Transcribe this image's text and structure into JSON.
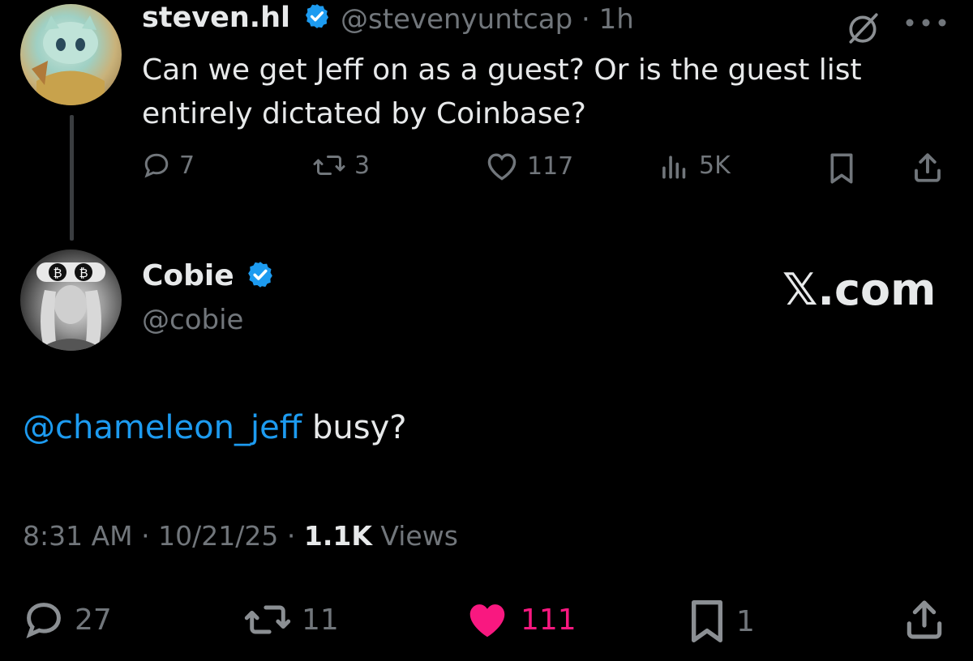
{
  "parent": {
    "display_name": "steven.hl",
    "handle": "@stevenyuntcap",
    "separator": "·",
    "time": "1h",
    "text": "Can we get Jeff on as a guest? Or is the guest list entirely dictated by Coinbase?",
    "counts": {
      "replies": "7",
      "reposts": "3",
      "likes": "117",
      "views": "5K"
    }
  },
  "main": {
    "display_name": "Cobie",
    "handle": "@cobie",
    "watermark": "𝕏.com",
    "mention": "@chameleon_jeff",
    "text_rest": " busy?",
    "time": "8:31 AM",
    "date": "10/21/25",
    "views_count": "1.1K",
    "views_label": "Views",
    "counts": {
      "replies": "27",
      "reposts": "11",
      "likes": "111",
      "bookmarks": "1"
    }
  },
  "colors": {
    "background": "#000000",
    "text": "#e7e9ea",
    "muted": "#71767b",
    "link": "#1d9bf0",
    "like": "#f91880",
    "verified": "#1d9bf0"
  },
  "icons": [
    "grok-icon",
    "more-icon",
    "reply-icon",
    "repost-icon",
    "like-icon",
    "views-icon",
    "bookmark-icon",
    "share-icon",
    "verified-icon"
  ]
}
